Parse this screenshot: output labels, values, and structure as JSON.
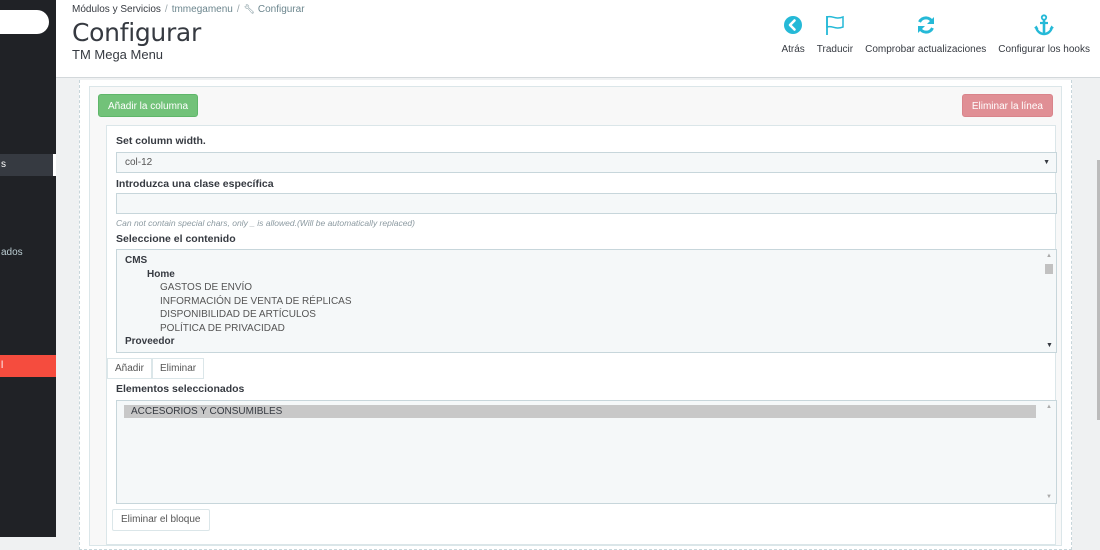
{
  "sidebar": {
    "items": [
      {
        "label": "s",
        "state": "current"
      },
      {
        "label": "ados",
        "state": "normal"
      },
      {
        "label": "l",
        "state": "danger"
      }
    ]
  },
  "header": {
    "breadcrumb": [
      "Módulos y Servicios",
      "tmmegamenu",
      "Configurar"
    ],
    "title": "Configurar",
    "subtitle": "TM Mega Menu",
    "toolbar": [
      {
        "label": "Atrás",
        "icon": "back-circle-icon"
      },
      {
        "label": "Traducir",
        "icon": "flag-icon"
      },
      {
        "label": "Comprobar actualizaciones",
        "icon": "refresh-icon"
      },
      {
        "label": "Configurar los hooks",
        "icon": "anchor-icon"
      }
    ]
  },
  "colors": {
    "accent": "#25b9d7",
    "success": "#72c279",
    "danger": "#e08f95",
    "sidebar_bg": "#202226"
  },
  "row": {
    "add_column_label": "Añadir la columna",
    "delete_line_label": "Eliminar la línea"
  },
  "column": {
    "width_label": "Set column width.",
    "width_value": "col-12",
    "class_label": "Introduzca una clase específica",
    "class_value": "",
    "class_help": "Can not contain special chars, only _ is allowed.(Will be automatically replaced)",
    "content_label": "Seleccione el contenido",
    "content_options": [
      {
        "label": "CMS",
        "level": 0
      },
      {
        "label": "Home",
        "level": 1
      },
      {
        "label": "GASTOS DE ENVÍO",
        "level": 2
      },
      {
        "label": "INFORMACIÓN DE VENTA DE RÉPLICAS",
        "level": 2
      },
      {
        "label": "DISPONIBILIDAD DE ARTÍCULOS",
        "level": 2
      },
      {
        "label": "POLÍTICA DE PRIVACIDAD",
        "level": 2
      },
      {
        "label": "Proveedor",
        "level": 0
      }
    ],
    "add_label": "Añadir",
    "remove_label": "Eliminar",
    "selected_label": "Elementos seleccionados",
    "selected_items": [
      "ACCESORIOS Y CONSUMIBLES"
    ],
    "delete_block_label": "Eliminar el bloque"
  }
}
